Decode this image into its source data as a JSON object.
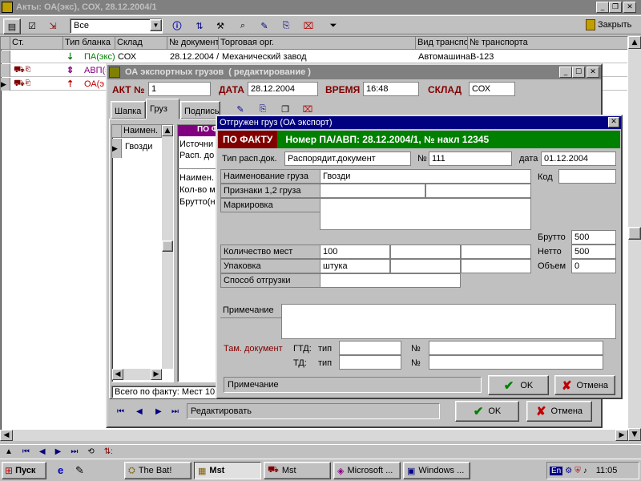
{
  "main": {
    "title": "Акты: ОА(экс), СОХ, 28.12.2004/1",
    "filter_value": "Все",
    "close_label": "Закрыть",
    "columns": [
      "Ст.",
      "Тип бланка",
      "Склад",
      "№ документа",
      "Торговая орг.",
      "Вид транспо",
      "№ транспорта"
    ],
    "rows": [
      {
        "type": "ПА(экс)",
        "sklad": "СОХ",
        "doc": "28.12.2004 /",
        "org": "Механический завод",
        "vid": "Автомашина",
        "num": "В-123"
      },
      {
        "type": "АВП(э",
        "sklad": "",
        "doc": "",
        "org": "",
        "vid": "",
        "num": ""
      },
      {
        "type": "ОА(э",
        "sklad": "",
        "doc": "",
        "org": "",
        "vid": "",
        "num": ""
      }
    ]
  },
  "export": {
    "title": "ОА экспортных грузов",
    "mode": "( редактирование )",
    "akt_label": "АКТ №",
    "akt_value": "1",
    "date_label": "ДАТА",
    "date_value": "28.12.2004",
    "time_label": "ВРЕМЯ",
    "time_value": "16:48",
    "sklad_label": "СКЛАД",
    "sklad_value": "СОХ",
    "tabs": [
      "Шапка",
      "Груз",
      "Подпись"
    ],
    "grid_header": "Наимен.",
    "grid_row": "Гвозди",
    "detail_header": "ПО Ф",
    "detail_lines": [
      "Источни",
      "Расп. до",
      "Наимен.",
      "Кол-во м",
      "Брутто(н"
    ],
    "total": "Всего по факту: Мест 10",
    "status": "Редактировать",
    "ok_label": "OK",
    "cancel_label": "Отмена"
  },
  "shipped": {
    "title": "Отгружен груз (ОА экспорт)",
    "fact_label": "ПО ФАКТУ",
    "fact_text": "Номер ПА/АВП: 28.12.2004/1, № накл 12345",
    "doc_type_label": "Тип расп.док.",
    "doc_type_value": "Распорядит.документ",
    "num_label": "№",
    "num_value": "111",
    "date_label": "дата",
    "date_value": "01.12.2004",
    "cargo_name_label": "Наименование груза",
    "cargo_name_value": "Гвозди",
    "signs_label": "Признаки 1,2 груза",
    "marking_label": "Маркировка",
    "kod_label": "Код",
    "brutto_label": "Брутто",
    "brutto_value": "500",
    "netto_label": "Нетто",
    "netto_value": "500",
    "volume_label": "Объем",
    "volume_value": "0",
    "places_label": "Количество мест",
    "places_value": "100",
    "pack_label": "Упаковка",
    "pack_value": "штука",
    "ship_method_label": "Способ отгрузки",
    "note_label": "Примечание",
    "customs_label": "Там. документ",
    "gtd_label": "ГТД:",
    "td_label": "ТД:",
    "tip_label": "тип",
    "n_label": "№",
    "status_note": "Примечание",
    "ok_label": "OK",
    "cancel_label": "Отмена"
  },
  "taskbar": {
    "start": "Пуск",
    "items": [
      "The Bat!",
      "Mst",
      "Mst",
      "Microsoft ...",
      "Windows ..."
    ],
    "lang": "En",
    "clock": "11:05"
  },
  "colors": {
    "title_blue": "#000080",
    "dark_red": "#800000",
    "green_bar": "#008000",
    "teal": "#008080"
  }
}
